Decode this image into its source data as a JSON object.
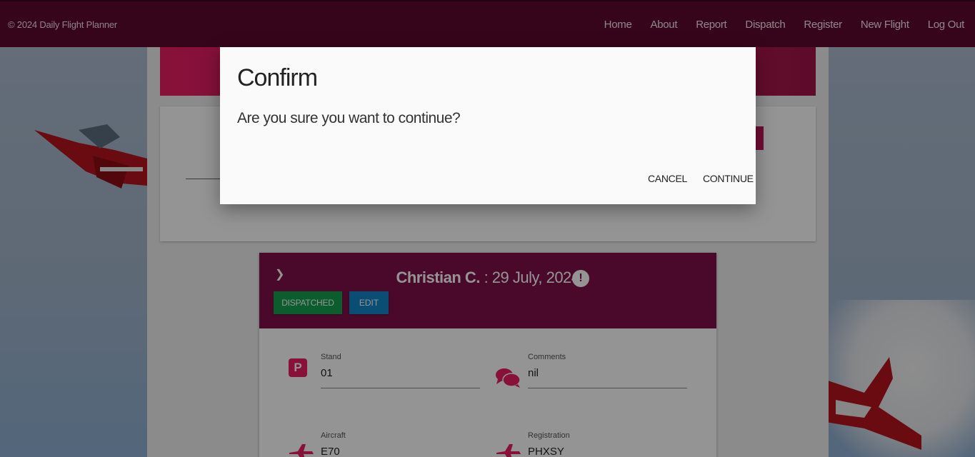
{
  "navbar": {
    "brand": "© 2024 Daily Flight Planner",
    "links": [
      "Home",
      "About",
      "Report",
      "Dispatch",
      "Register",
      "New Flight",
      "Log Out"
    ]
  },
  "flight_card": {
    "pilot": "Christian C.",
    "date": ": 29 July, 2024",
    "status_button": "DISPATCHED",
    "edit_button": "EDIT",
    "fields": {
      "stand": {
        "label": "Stand",
        "value": "01"
      },
      "comments": {
        "label": "Comments",
        "value": "nil"
      },
      "aircraft": {
        "label": "Aircraft",
        "value": "E70"
      },
      "registration": {
        "label": "Registration",
        "value": "PHXSY"
      }
    }
  },
  "dialog": {
    "title": "Confirm",
    "message": "Are you sure you want to continue?",
    "cancel_label": "CANCEL",
    "continue_label": "CONTINUE"
  },
  "colors": {
    "navbar": "#5e0a31",
    "accent": "#e91e63",
    "card_header": "#80104a",
    "dispatched": "#14a050",
    "edit": "#1487c9"
  }
}
